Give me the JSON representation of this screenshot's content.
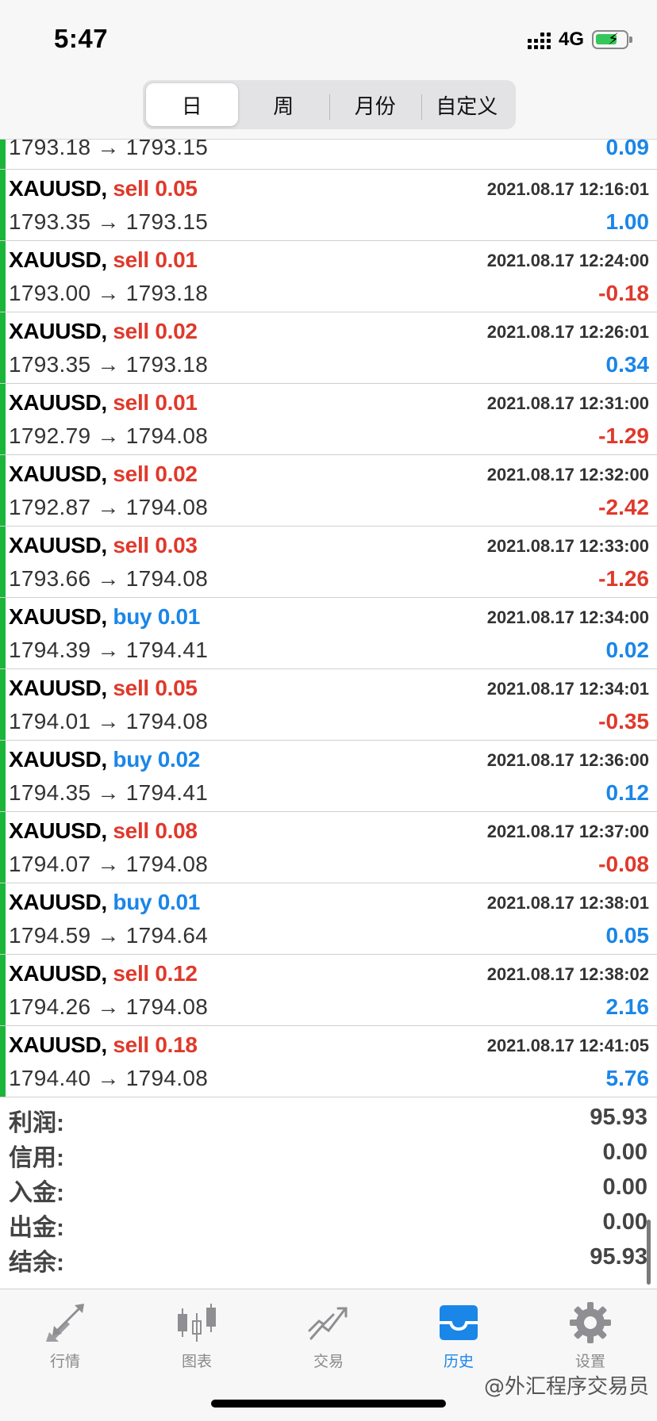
{
  "status_bar": {
    "time": "5:47",
    "network": "4G"
  },
  "period_tabs": [
    {
      "label": "日",
      "active": true
    },
    {
      "label": "周",
      "active": false
    },
    {
      "label": "月份",
      "active": false
    },
    {
      "label": "自定义",
      "active": false
    }
  ],
  "partial_row": {
    "prices": "1793.18 → 1793.15",
    "profit": "0.09"
  },
  "trades": [
    {
      "symbol": "XAUUSD,",
      "side": "sell 0.05",
      "time": "2021.08.17 12:16:01",
      "prices": "1793.35 → 1793.15",
      "profit": "1.00"
    },
    {
      "symbol": "XAUUSD,",
      "side": "sell 0.01",
      "time": "2021.08.17 12:24:00",
      "prices": "1793.00 → 1793.18",
      "profit": "-0.18"
    },
    {
      "symbol": "XAUUSD,",
      "side": "sell 0.02",
      "time": "2021.08.17 12:26:01",
      "prices": "1793.35 → 1793.18",
      "profit": "0.34"
    },
    {
      "symbol": "XAUUSD,",
      "side": "sell 0.01",
      "time": "2021.08.17 12:31:00",
      "prices": "1792.79 → 1794.08",
      "profit": "-1.29"
    },
    {
      "symbol": "XAUUSD,",
      "side": "sell 0.02",
      "time": "2021.08.17 12:32:00",
      "prices": "1792.87 → 1794.08",
      "profit": "-2.42"
    },
    {
      "symbol": "XAUUSD,",
      "side": "sell 0.03",
      "time": "2021.08.17 12:33:00",
      "prices": "1793.66 → 1794.08",
      "profit": "-1.26"
    },
    {
      "symbol": "XAUUSD,",
      "side": "buy 0.01",
      "time": "2021.08.17 12:34:00",
      "prices": "1794.39 → 1794.41",
      "profit": "0.02"
    },
    {
      "symbol": "XAUUSD,",
      "side": "sell 0.05",
      "time": "2021.08.17 12:34:01",
      "prices": "1794.01 → 1794.08",
      "profit": "-0.35"
    },
    {
      "symbol": "XAUUSD,",
      "side": "buy 0.02",
      "time": "2021.08.17 12:36:00",
      "prices": "1794.35 → 1794.41",
      "profit": "0.12"
    },
    {
      "symbol": "XAUUSD,",
      "side": "sell 0.08",
      "time": "2021.08.17 12:37:00",
      "prices": "1794.07 → 1794.08",
      "profit": "-0.08"
    },
    {
      "symbol": "XAUUSD,",
      "side": "buy 0.01",
      "time": "2021.08.17 12:38:01",
      "prices": "1794.59 → 1794.64",
      "profit": "0.05"
    },
    {
      "symbol": "XAUUSD,",
      "side": "sell 0.12",
      "time": "2021.08.17 12:38:02",
      "prices": "1794.26 → 1794.08",
      "profit": "2.16"
    },
    {
      "symbol": "XAUUSD,",
      "side": "sell 0.18",
      "time": "2021.08.17 12:41:05",
      "prices": "1794.40 → 1794.08",
      "profit": "5.76"
    }
  ],
  "summary": [
    {
      "label": "利润:",
      "value": "95.93"
    },
    {
      "label": "信用:",
      "value": "0.00"
    },
    {
      "label": "入金:",
      "value": "0.00"
    },
    {
      "label": "出金:",
      "value": "0.00"
    },
    {
      "label": "结余:",
      "value": "95.93"
    }
  ],
  "tabbar": [
    {
      "label": "行情",
      "icon": "quotes-arrows-icon",
      "active": false
    },
    {
      "label": "图表",
      "icon": "candlestick-chart-icon",
      "active": false
    },
    {
      "label": "交易",
      "icon": "trade-trend-icon",
      "active": false
    },
    {
      "label": "历史",
      "icon": "history-inbox-icon",
      "active": true
    },
    {
      "label": "设置",
      "icon": "gear-icon",
      "active": false
    }
  ],
  "watermark": "@外汇程序交易员",
  "colors": {
    "sell": "#e0392b",
    "buy": "#1a86e8",
    "profit_positive": "#1a86e8",
    "profit_negative": "#e0392b",
    "trade_bar": "#1bb539",
    "active_tab": "#1a86e8",
    "inactive_tab": "#8a8a8a"
  }
}
